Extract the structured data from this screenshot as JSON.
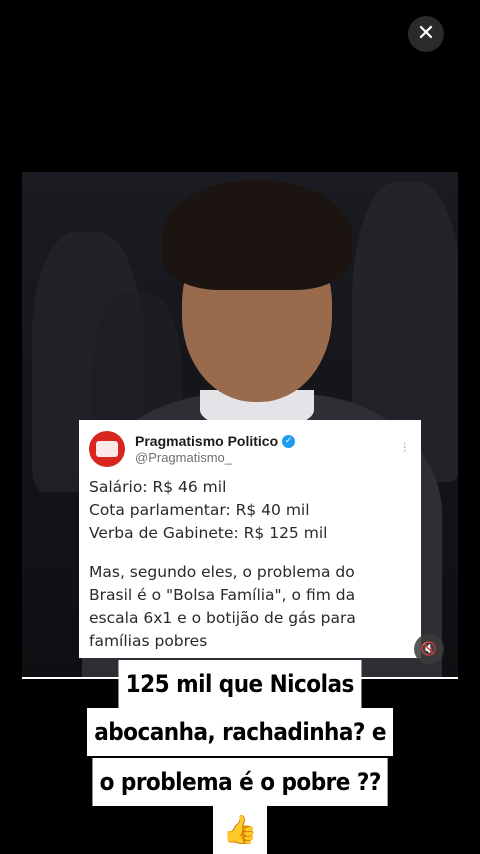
{
  "close_button": {
    "symbol": "✕"
  },
  "tweet": {
    "display_name": "Pragmatismo Politico",
    "handle": "@Pragmatismo_",
    "verified_symbol": "✓",
    "more_symbol": "⁝",
    "avatar_color": "#d8261f",
    "lines": [
      "Salário: R$ 46 mil",
      "Cota parlamentar: R$ 40 mil",
      "Verba de Gabinete: R$ 125 mil"
    ],
    "paragraph": "Mas, segundo eles, o problema do\nBrasil é o \"Bolsa Família\", o fim da\nescala 6x1 e o botijão de gás para\nfamílias pobres"
  },
  "mute_button": {
    "icon": "speaker-muted-icon",
    "symbol": "🔇"
  },
  "caption": {
    "line1": "125 mil que Nicolas",
    "line2": "abocanha, rachadinha? e",
    "line3": "o problema é o pobre ??",
    "emoji": "👍"
  }
}
